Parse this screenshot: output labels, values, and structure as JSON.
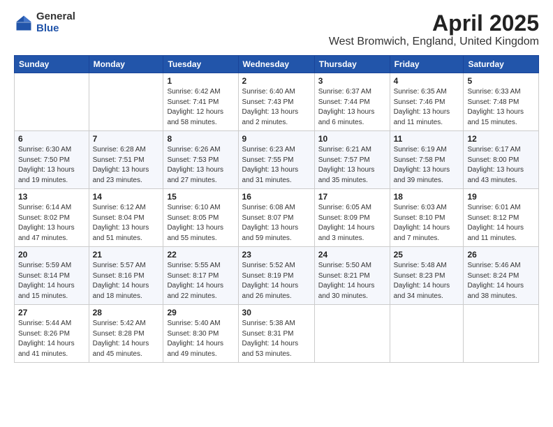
{
  "logo": {
    "general": "General",
    "blue": "Blue"
  },
  "title": "April 2025",
  "subtitle": "West Bromwich, England, United Kingdom",
  "weekdays": [
    "Sunday",
    "Monday",
    "Tuesday",
    "Wednesday",
    "Thursday",
    "Friday",
    "Saturday"
  ],
  "weeks": [
    [
      {
        "day": "",
        "detail": ""
      },
      {
        "day": "",
        "detail": ""
      },
      {
        "day": "1",
        "detail": "Sunrise: 6:42 AM\nSunset: 7:41 PM\nDaylight: 12 hours\nand 58 minutes."
      },
      {
        "day": "2",
        "detail": "Sunrise: 6:40 AM\nSunset: 7:43 PM\nDaylight: 13 hours\nand 2 minutes."
      },
      {
        "day": "3",
        "detail": "Sunrise: 6:37 AM\nSunset: 7:44 PM\nDaylight: 13 hours\nand 6 minutes."
      },
      {
        "day": "4",
        "detail": "Sunrise: 6:35 AM\nSunset: 7:46 PM\nDaylight: 13 hours\nand 11 minutes."
      },
      {
        "day": "5",
        "detail": "Sunrise: 6:33 AM\nSunset: 7:48 PM\nDaylight: 13 hours\nand 15 minutes."
      }
    ],
    [
      {
        "day": "6",
        "detail": "Sunrise: 6:30 AM\nSunset: 7:50 PM\nDaylight: 13 hours\nand 19 minutes."
      },
      {
        "day": "7",
        "detail": "Sunrise: 6:28 AM\nSunset: 7:51 PM\nDaylight: 13 hours\nand 23 minutes."
      },
      {
        "day": "8",
        "detail": "Sunrise: 6:26 AM\nSunset: 7:53 PM\nDaylight: 13 hours\nand 27 minutes."
      },
      {
        "day": "9",
        "detail": "Sunrise: 6:23 AM\nSunset: 7:55 PM\nDaylight: 13 hours\nand 31 minutes."
      },
      {
        "day": "10",
        "detail": "Sunrise: 6:21 AM\nSunset: 7:57 PM\nDaylight: 13 hours\nand 35 minutes."
      },
      {
        "day": "11",
        "detail": "Sunrise: 6:19 AM\nSunset: 7:58 PM\nDaylight: 13 hours\nand 39 minutes."
      },
      {
        "day": "12",
        "detail": "Sunrise: 6:17 AM\nSunset: 8:00 PM\nDaylight: 13 hours\nand 43 minutes."
      }
    ],
    [
      {
        "day": "13",
        "detail": "Sunrise: 6:14 AM\nSunset: 8:02 PM\nDaylight: 13 hours\nand 47 minutes."
      },
      {
        "day": "14",
        "detail": "Sunrise: 6:12 AM\nSunset: 8:04 PM\nDaylight: 13 hours\nand 51 minutes."
      },
      {
        "day": "15",
        "detail": "Sunrise: 6:10 AM\nSunset: 8:05 PM\nDaylight: 13 hours\nand 55 minutes."
      },
      {
        "day": "16",
        "detail": "Sunrise: 6:08 AM\nSunset: 8:07 PM\nDaylight: 13 hours\nand 59 minutes."
      },
      {
        "day": "17",
        "detail": "Sunrise: 6:05 AM\nSunset: 8:09 PM\nDaylight: 14 hours\nand 3 minutes."
      },
      {
        "day": "18",
        "detail": "Sunrise: 6:03 AM\nSunset: 8:10 PM\nDaylight: 14 hours\nand 7 minutes."
      },
      {
        "day": "19",
        "detail": "Sunrise: 6:01 AM\nSunset: 8:12 PM\nDaylight: 14 hours\nand 11 minutes."
      }
    ],
    [
      {
        "day": "20",
        "detail": "Sunrise: 5:59 AM\nSunset: 8:14 PM\nDaylight: 14 hours\nand 15 minutes."
      },
      {
        "day": "21",
        "detail": "Sunrise: 5:57 AM\nSunset: 8:16 PM\nDaylight: 14 hours\nand 18 minutes."
      },
      {
        "day": "22",
        "detail": "Sunrise: 5:55 AM\nSunset: 8:17 PM\nDaylight: 14 hours\nand 22 minutes."
      },
      {
        "day": "23",
        "detail": "Sunrise: 5:52 AM\nSunset: 8:19 PM\nDaylight: 14 hours\nand 26 minutes."
      },
      {
        "day": "24",
        "detail": "Sunrise: 5:50 AM\nSunset: 8:21 PM\nDaylight: 14 hours\nand 30 minutes."
      },
      {
        "day": "25",
        "detail": "Sunrise: 5:48 AM\nSunset: 8:23 PM\nDaylight: 14 hours\nand 34 minutes."
      },
      {
        "day": "26",
        "detail": "Sunrise: 5:46 AM\nSunset: 8:24 PM\nDaylight: 14 hours\nand 38 minutes."
      }
    ],
    [
      {
        "day": "27",
        "detail": "Sunrise: 5:44 AM\nSunset: 8:26 PM\nDaylight: 14 hours\nand 41 minutes."
      },
      {
        "day": "28",
        "detail": "Sunrise: 5:42 AM\nSunset: 8:28 PM\nDaylight: 14 hours\nand 45 minutes."
      },
      {
        "day": "29",
        "detail": "Sunrise: 5:40 AM\nSunset: 8:30 PM\nDaylight: 14 hours\nand 49 minutes."
      },
      {
        "day": "30",
        "detail": "Sunrise: 5:38 AM\nSunset: 8:31 PM\nDaylight: 14 hours\nand 53 minutes."
      },
      {
        "day": "",
        "detail": ""
      },
      {
        "day": "",
        "detail": ""
      },
      {
        "day": "",
        "detail": ""
      }
    ]
  ]
}
